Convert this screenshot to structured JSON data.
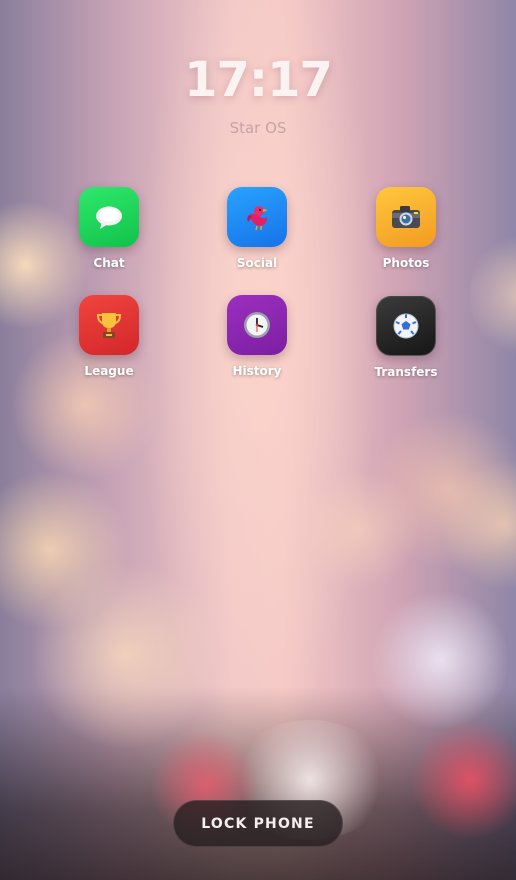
{
  "status": {
    "time": "17:17",
    "os_name": "Star OS"
  },
  "apps": [
    {
      "label": "Chat",
      "icon": "speech-bubble-icon",
      "color": "#1fd65b"
    },
    {
      "label": "Social",
      "icon": "bird-icon",
      "color": "#1e90f5"
    },
    {
      "label": "Photos",
      "icon": "camera-icon",
      "color": "#f4b52c"
    },
    {
      "label": "League",
      "icon": "trophy-icon",
      "color": "#e53935"
    },
    {
      "label": "History",
      "icon": "clock-icon",
      "color": "#8e24aa"
    },
    {
      "label": "Transfers",
      "icon": "soccer-ball-icon",
      "color": "#2a2a2a"
    }
  ],
  "lock_button": {
    "label": "LOCK PHONE"
  }
}
